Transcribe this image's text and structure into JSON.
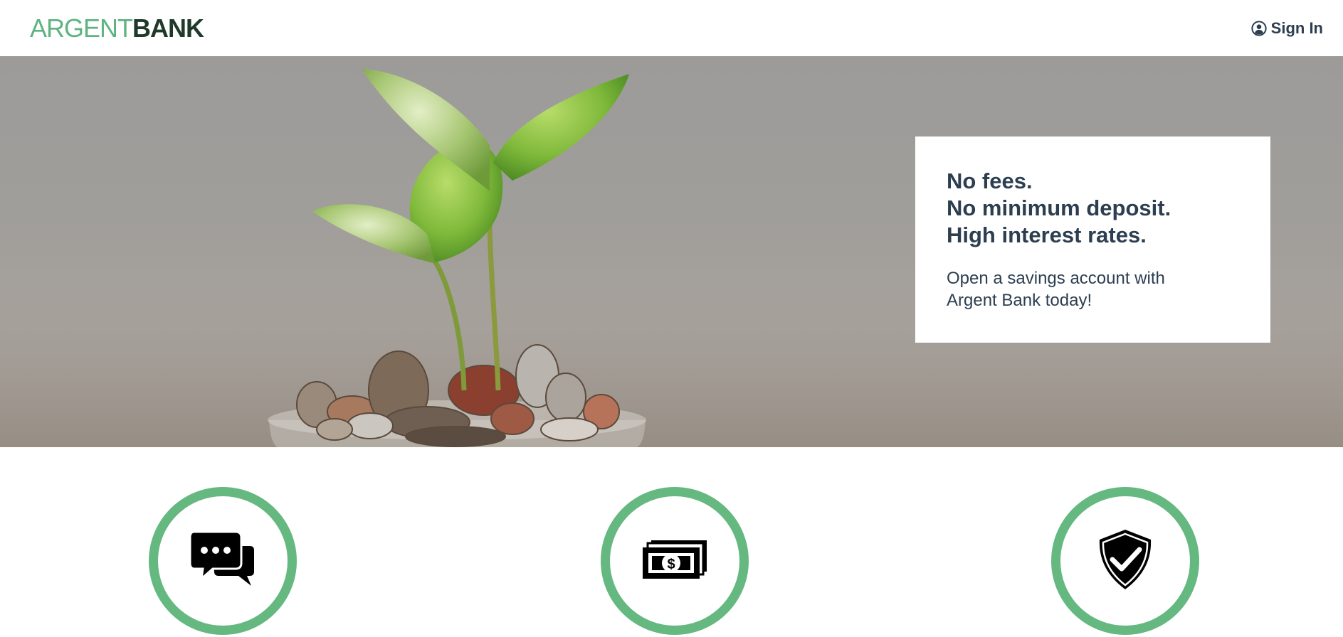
{
  "nav": {
    "logo_part_1": "ARGENT",
    "logo_part_2": "BANK",
    "signin_label": "Sign In",
    "signin_icon": "user-circle-icon"
  },
  "hero": {
    "subtitles": [
      "No fees.",
      "No minimum deposit.",
      "High interest rates."
    ],
    "text": "Open a savings account with Argent Bank today!"
  },
  "features": [
    {
      "icon": "chat-icon"
    },
    {
      "icon": "money-icon"
    },
    {
      "icon": "security-shield-icon"
    }
  ],
  "colors": {
    "accent": "#65b880",
    "text": "#2c3e50",
    "logo_dark": "#1f3a2a"
  }
}
